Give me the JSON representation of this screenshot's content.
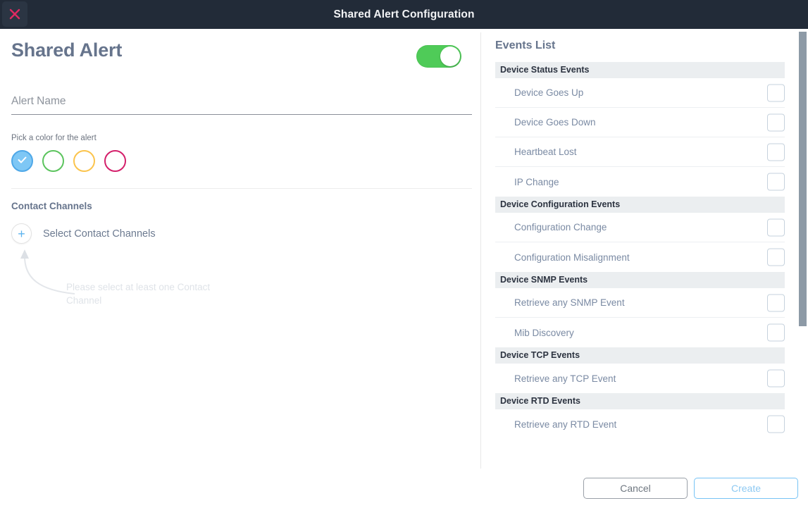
{
  "titlebar": {
    "title": "Shared Alert Configuration",
    "close_icon": "close-icon"
  },
  "left": {
    "page_title": "Shared Alert",
    "toggle": {
      "state": "on",
      "color": "#4fcb58"
    },
    "alert_name": {
      "placeholder": "Alert Name",
      "value": ""
    },
    "color_picker": {
      "label": "Pick a color for the alert",
      "selected_index": 0,
      "swatches": [
        {
          "name": "blue",
          "color": "#7ec7f5",
          "border": "#4fa8e8",
          "selected": true
        },
        {
          "name": "green",
          "color": "#ffffff",
          "border": "#5cc45e",
          "selected": false
        },
        {
          "name": "yellow",
          "color": "#ffffff",
          "border": "#fbc44d",
          "selected": false
        },
        {
          "name": "pink",
          "color": "#ffffff",
          "border": "#d4206b",
          "selected": false
        }
      ]
    },
    "contact_channels": {
      "section_label": "Contact Channels",
      "add_label": "Select Contact Channels",
      "add_icon": "plus-icon",
      "hint": "Please select at least one Contact Channel"
    }
  },
  "right": {
    "title": "Events List",
    "groups": [
      {
        "name": "Device Status Events",
        "items": [
          {
            "label": "Device Goes Up",
            "checked": false
          },
          {
            "label": "Device Goes Down",
            "checked": false
          },
          {
            "label": "Heartbeat Lost",
            "checked": false
          },
          {
            "label": "IP Change",
            "checked": false
          }
        ]
      },
      {
        "name": "Device Configuration Events",
        "items": [
          {
            "label": "Configuration Change",
            "checked": false
          },
          {
            "label": "Configuration Misalignment",
            "checked": false
          }
        ]
      },
      {
        "name": "Device SNMP Events",
        "items": [
          {
            "label": "Retrieve any SNMP Event",
            "checked": false
          },
          {
            "label": "Mib Discovery",
            "checked": false
          }
        ]
      },
      {
        "name": "Device TCP Events",
        "items": [
          {
            "label": "Retrieve any TCP Event",
            "checked": false
          }
        ]
      },
      {
        "name": "Device RTD Events",
        "items": [
          {
            "label": "Retrieve any RTD Event",
            "checked": false
          }
        ]
      }
    ]
  },
  "footer": {
    "cancel_label": "Cancel",
    "create_label": "Create"
  },
  "colors": {
    "titlebar_bg": "#222b38",
    "accent_blue": "#5cb3ef",
    "toggle_green": "#4fcb58",
    "close_pink": "#e02a62",
    "heading": "#66748c"
  }
}
